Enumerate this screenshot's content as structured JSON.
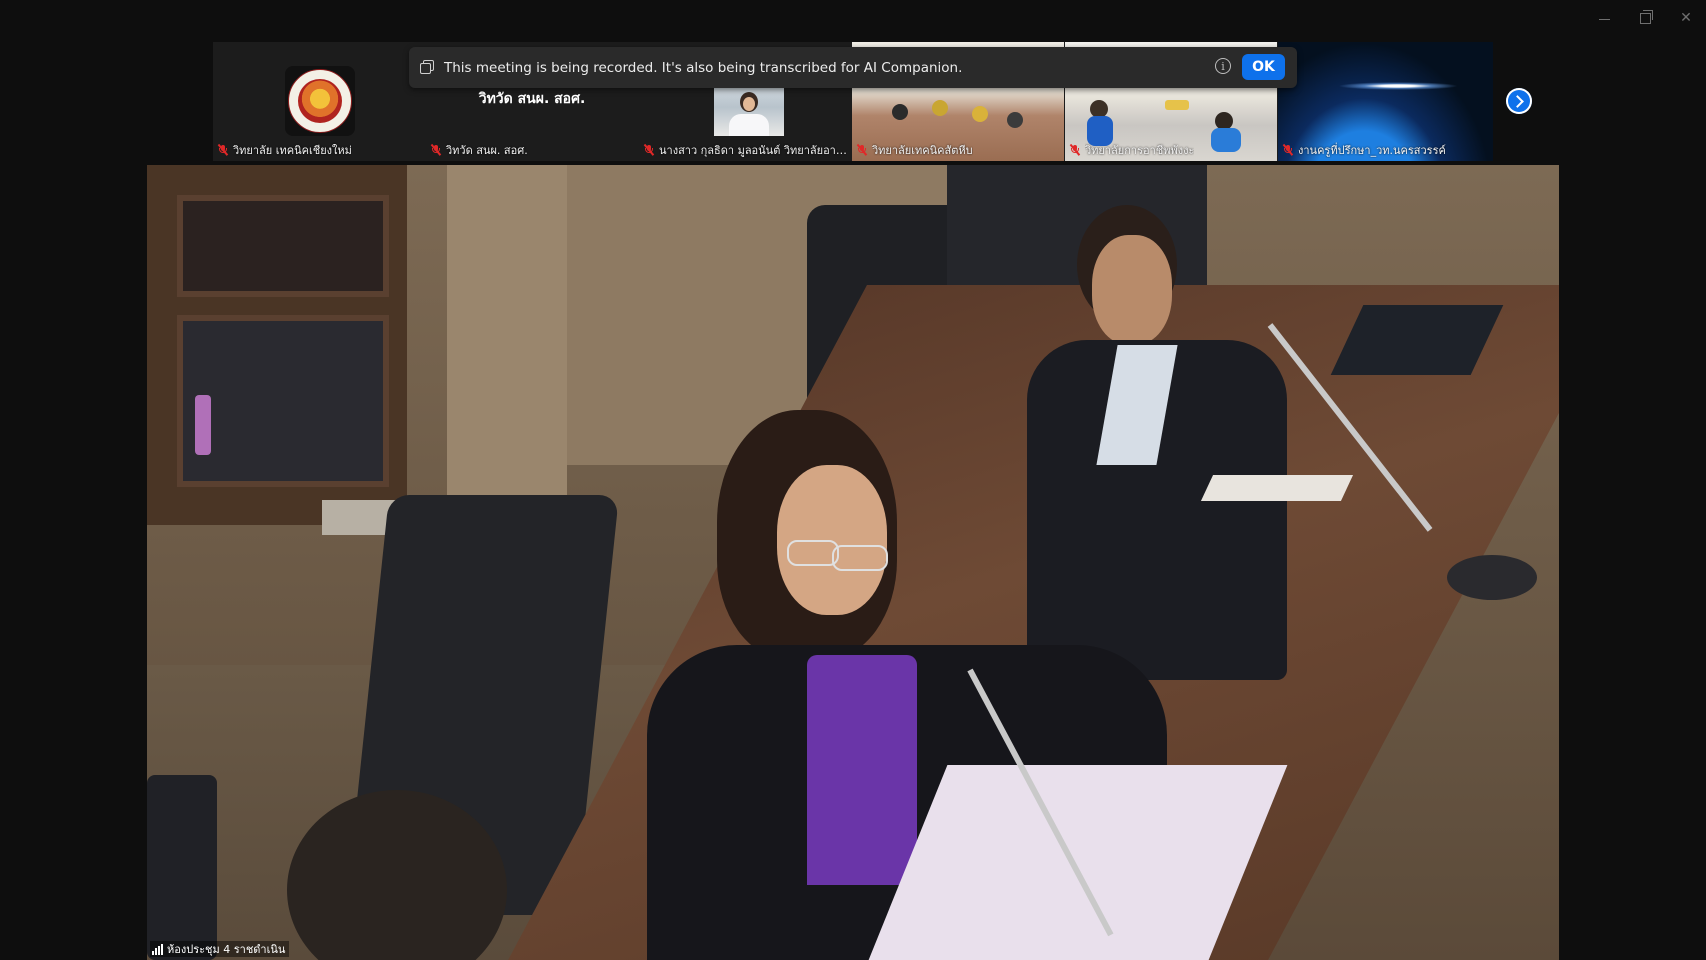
{
  "window": {
    "controls": [
      "minimize-icon",
      "restore-icon",
      "close-icon"
    ],
    "close_glyph": "✕"
  },
  "banner": {
    "message": "This meeting is being recorded. It's also being transcribed for AI Companion.",
    "info_glyph": "i",
    "ok_label": "OK"
  },
  "gallery": {
    "tiles": [
      {
        "name": "วิทยาลัย เทคนิคเชียงใหม่",
        "view": "logo"
      },
      {
        "name": "วิทวัด สนผ. สอศ.",
        "view": "name-card",
        "card_text": "วิทวัด สนผ. สอศ."
      },
      {
        "name": "นางสาว กุลธิดา มูลอนันต์ วิทยาลัยอาชีวศ...",
        "view": "portrait"
      },
      {
        "name": "วิทยาลัยเทคนิคสัตหีบ",
        "view": "video"
      },
      {
        "name": "วิทยาลัยการอาชีพพังงะ",
        "view": "video"
      },
      {
        "name": "งานครูที่ปรึกษา_วท.นครสวรรค์",
        "view": "video"
      }
    ],
    "next_icon": "chevron-right-icon"
  },
  "main_video": {
    "speaker_name": "ห้องประชุม 4 ราชดำเนิน"
  },
  "colors": {
    "accent": "#0e71eb",
    "mic_muted": "#e02828",
    "banner_bg": "#2a2a2a",
    "background": "#0e0e0e"
  }
}
